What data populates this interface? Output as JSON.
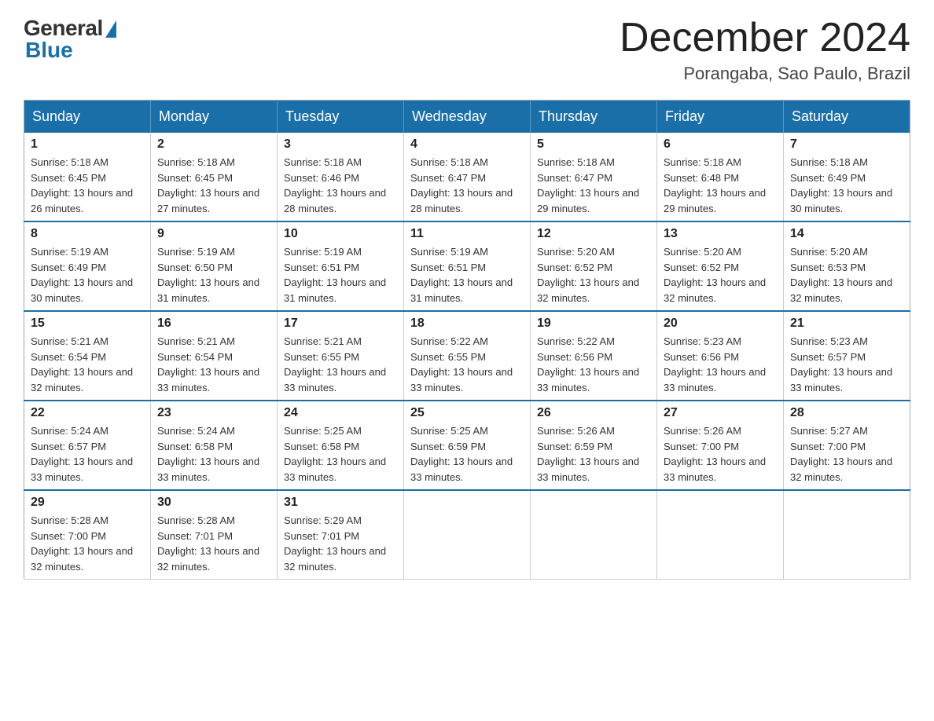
{
  "header": {
    "logo": {
      "general_text": "General",
      "blue_text": "Blue"
    },
    "title": "December 2024",
    "location": "Porangaba, Sao Paulo, Brazil"
  },
  "weekdays": [
    "Sunday",
    "Monday",
    "Tuesday",
    "Wednesday",
    "Thursday",
    "Friday",
    "Saturday"
  ],
  "weeks": [
    [
      {
        "day": "1",
        "sunrise": "Sunrise: 5:18 AM",
        "sunset": "Sunset: 6:45 PM",
        "daylight": "Daylight: 13 hours and 26 minutes."
      },
      {
        "day": "2",
        "sunrise": "Sunrise: 5:18 AM",
        "sunset": "Sunset: 6:45 PM",
        "daylight": "Daylight: 13 hours and 27 minutes."
      },
      {
        "day": "3",
        "sunrise": "Sunrise: 5:18 AM",
        "sunset": "Sunset: 6:46 PM",
        "daylight": "Daylight: 13 hours and 28 minutes."
      },
      {
        "day": "4",
        "sunrise": "Sunrise: 5:18 AM",
        "sunset": "Sunset: 6:47 PM",
        "daylight": "Daylight: 13 hours and 28 minutes."
      },
      {
        "day": "5",
        "sunrise": "Sunrise: 5:18 AM",
        "sunset": "Sunset: 6:47 PM",
        "daylight": "Daylight: 13 hours and 29 minutes."
      },
      {
        "day": "6",
        "sunrise": "Sunrise: 5:18 AM",
        "sunset": "Sunset: 6:48 PM",
        "daylight": "Daylight: 13 hours and 29 minutes."
      },
      {
        "day": "7",
        "sunrise": "Sunrise: 5:18 AM",
        "sunset": "Sunset: 6:49 PM",
        "daylight": "Daylight: 13 hours and 30 minutes."
      }
    ],
    [
      {
        "day": "8",
        "sunrise": "Sunrise: 5:19 AM",
        "sunset": "Sunset: 6:49 PM",
        "daylight": "Daylight: 13 hours and 30 minutes."
      },
      {
        "day": "9",
        "sunrise": "Sunrise: 5:19 AM",
        "sunset": "Sunset: 6:50 PM",
        "daylight": "Daylight: 13 hours and 31 minutes."
      },
      {
        "day": "10",
        "sunrise": "Sunrise: 5:19 AM",
        "sunset": "Sunset: 6:51 PM",
        "daylight": "Daylight: 13 hours and 31 minutes."
      },
      {
        "day": "11",
        "sunrise": "Sunrise: 5:19 AM",
        "sunset": "Sunset: 6:51 PM",
        "daylight": "Daylight: 13 hours and 31 minutes."
      },
      {
        "day": "12",
        "sunrise": "Sunrise: 5:20 AM",
        "sunset": "Sunset: 6:52 PM",
        "daylight": "Daylight: 13 hours and 32 minutes."
      },
      {
        "day": "13",
        "sunrise": "Sunrise: 5:20 AM",
        "sunset": "Sunset: 6:52 PM",
        "daylight": "Daylight: 13 hours and 32 minutes."
      },
      {
        "day": "14",
        "sunrise": "Sunrise: 5:20 AM",
        "sunset": "Sunset: 6:53 PM",
        "daylight": "Daylight: 13 hours and 32 minutes."
      }
    ],
    [
      {
        "day": "15",
        "sunrise": "Sunrise: 5:21 AM",
        "sunset": "Sunset: 6:54 PM",
        "daylight": "Daylight: 13 hours and 32 minutes."
      },
      {
        "day": "16",
        "sunrise": "Sunrise: 5:21 AM",
        "sunset": "Sunset: 6:54 PM",
        "daylight": "Daylight: 13 hours and 33 minutes."
      },
      {
        "day": "17",
        "sunrise": "Sunrise: 5:21 AM",
        "sunset": "Sunset: 6:55 PM",
        "daylight": "Daylight: 13 hours and 33 minutes."
      },
      {
        "day": "18",
        "sunrise": "Sunrise: 5:22 AM",
        "sunset": "Sunset: 6:55 PM",
        "daylight": "Daylight: 13 hours and 33 minutes."
      },
      {
        "day": "19",
        "sunrise": "Sunrise: 5:22 AM",
        "sunset": "Sunset: 6:56 PM",
        "daylight": "Daylight: 13 hours and 33 minutes."
      },
      {
        "day": "20",
        "sunrise": "Sunrise: 5:23 AM",
        "sunset": "Sunset: 6:56 PM",
        "daylight": "Daylight: 13 hours and 33 minutes."
      },
      {
        "day": "21",
        "sunrise": "Sunrise: 5:23 AM",
        "sunset": "Sunset: 6:57 PM",
        "daylight": "Daylight: 13 hours and 33 minutes."
      }
    ],
    [
      {
        "day": "22",
        "sunrise": "Sunrise: 5:24 AM",
        "sunset": "Sunset: 6:57 PM",
        "daylight": "Daylight: 13 hours and 33 minutes."
      },
      {
        "day": "23",
        "sunrise": "Sunrise: 5:24 AM",
        "sunset": "Sunset: 6:58 PM",
        "daylight": "Daylight: 13 hours and 33 minutes."
      },
      {
        "day": "24",
        "sunrise": "Sunrise: 5:25 AM",
        "sunset": "Sunset: 6:58 PM",
        "daylight": "Daylight: 13 hours and 33 minutes."
      },
      {
        "day": "25",
        "sunrise": "Sunrise: 5:25 AM",
        "sunset": "Sunset: 6:59 PM",
        "daylight": "Daylight: 13 hours and 33 minutes."
      },
      {
        "day": "26",
        "sunrise": "Sunrise: 5:26 AM",
        "sunset": "Sunset: 6:59 PM",
        "daylight": "Daylight: 13 hours and 33 minutes."
      },
      {
        "day": "27",
        "sunrise": "Sunrise: 5:26 AM",
        "sunset": "Sunset: 7:00 PM",
        "daylight": "Daylight: 13 hours and 33 minutes."
      },
      {
        "day": "28",
        "sunrise": "Sunrise: 5:27 AM",
        "sunset": "Sunset: 7:00 PM",
        "daylight": "Daylight: 13 hours and 32 minutes."
      }
    ],
    [
      {
        "day": "29",
        "sunrise": "Sunrise: 5:28 AM",
        "sunset": "Sunset: 7:00 PM",
        "daylight": "Daylight: 13 hours and 32 minutes."
      },
      {
        "day": "30",
        "sunrise": "Sunrise: 5:28 AM",
        "sunset": "Sunset: 7:01 PM",
        "daylight": "Daylight: 13 hours and 32 minutes."
      },
      {
        "day": "31",
        "sunrise": "Sunrise: 5:29 AM",
        "sunset": "Sunset: 7:01 PM",
        "daylight": "Daylight: 13 hours and 32 minutes."
      },
      null,
      null,
      null,
      null
    ]
  ]
}
